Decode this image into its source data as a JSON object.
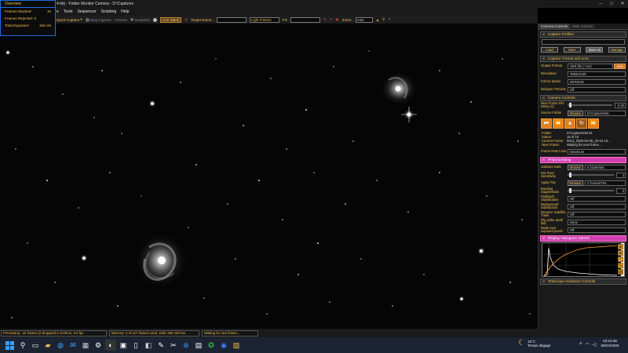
{
  "window": {
    "title": "4 bit) - Folder Monitor Camera - D:\\Captures"
  },
  "menu": [
    "e",
    "Tools",
    "Sequencer",
    "Scripting",
    "Help"
  ],
  "toolbar": {
    "quick_capture": "Quick Capture",
    "stop_capture": "Stop Capture",
    "pause": "Pause",
    "snapshot": "Snapshot",
    "live_stack": "Live Stack",
    "target_name_label": "Target Name :",
    "target_name_value": "",
    "light_frames": "Light Frames",
    "fx_label": "FX",
    "fx_value": "",
    "zoom_label": "Zoom:",
    "zoom_value": "Auto"
  },
  "overview": {
    "title": "Overview",
    "rows": [
      {
        "label": "Frames Stacked:",
        "value": "15"
      },
      {
        "label": "Frames Rejected: 0",
        "value": ""
      },
      {
        "label": "Total Exposure:",
        "value": "15m 0s"
      }
    ]
  },
  "panel": {
    "tabs": [
      "Camera Controls",
      "Multi Column"
    ],
    "capture_profiles": {
      "title": "Capture Profiles",
      "buttons": [
        "Load",
        "Save",
        "Save As",
        "Manage"
      ]
    },
    "capture_format": {
      "title": "Capture Format and Area",
      "output_format_label": "Output Format",
      "output_format_value": "SER file (*.ser)",
      "auto_button": "Auto",
      "resolution_label": "Resolution",
      "resolution_value": "3856x2180",
      "colour_space_label": "Colour Space",
      "colour_space_value": "MONO16",
      "debayer_label": "Debayer Preview",
      "debayer_value": "Off"
    },
    "camera_controls": {
      "title": "Camera Controls",
      "new_frame_label": "New Frame File Delay (s)",
      "new_frame_value": "5.00",
      "source_folder_label": "Source Folder",
      "browse": "Browse",
      "source_folder_value": "D:\\Captures\\M..."
    },
    "transport": [
      "⏮",
      "⏪",
      "⏸",
      "↻",
      "⏩"
    ],
    "info": [
      {
        "k": "Folder:",
        "v": "D:\\Captures\\M 81"
      },
      {
        "k": "Status:",
        "v": "15 of 15"
      },
      {
        "k": "Current Frame:",
        "v": "0014_2026-04-06_23-22-16..."
      },
      {
        "k": "Next Frame:",
        "v": "Waiting for next frame..."
      }
    ],
    "frame_rate_label": "Frame Rate Limit",
    "frame_rate_value": "Maximum",
    "preprocessing": {
      "title": "Preprocessing",
      "subtract_dark_label": "Subtract Dark",
      "subtract_dark_browse": "Browse",
      "subtract_dark_value": "E:\\darks\\Mi...",
      "hot_pixel_label": "Hot Pixel Sensitivity",
      "hot_pixel_value": "3",
      "apply_flat_label": "Apply Flat",
      "apply_flat_browse": "Browse",
      "apply_flat_value": "C:\\Users\\Tris...",
      "banding_label": "Banding Suppression",
      "banding_value": "0",
      "flatdark_label": "Flat/Dark Stabilization",
      "flatdark_value": "Off",
      "background_label": "Background Subtraction",
      "background_value": "Off",
      "satellite_label": "Remove Satellite Trails",
      "satellite_value": "Off",
      "flip_label": "Flip (after dark/ flat)",
      "flip_value": "None",
      "mask_label": "Mask over exposed pixels",
      "mask_value": "Off"
    },
    "histogram_title": "Display Histogram Stretch",
    "telescope_title": "Telescope Hardware Controls"
  },
  "status": {
    "preview": "Previewing : 16 frames (0 dropped) in 0:09:41, 0.0 fps",
    "memory": "Memory: 4 of 127 frames used, Disk: 836 GB free",
    "waiting": "Waiting for next frame..."
  },
  "taskbar": {
    "weather_temp": "15°C",
    "weather_desc": "Temps dégagé",
    "time": "23:23:36",
    "date": "06/04/2026"
  }
}
